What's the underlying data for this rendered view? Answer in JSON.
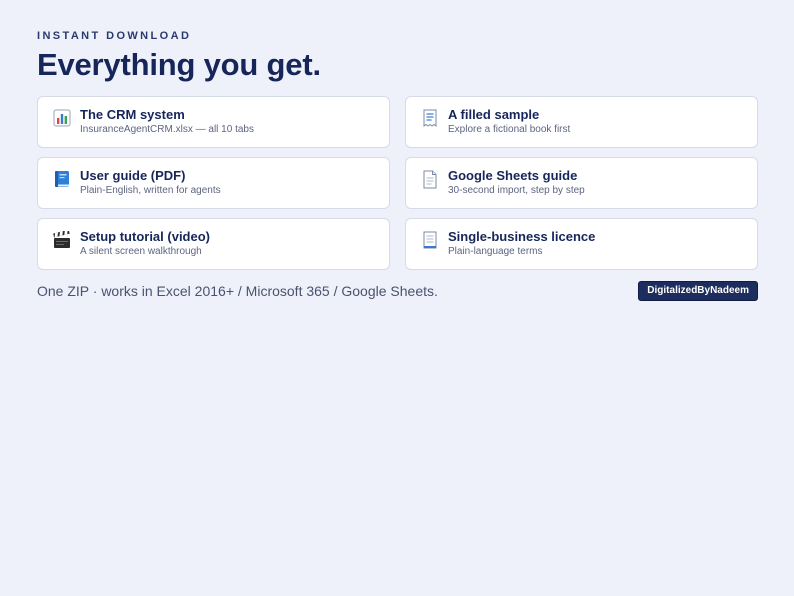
{
  "header": {
    "eyebrow": "INSTANT DOWNLOAD",
    "title": "Everything you get."
  },
  "items": [
    {
      "icon": "bar-chart-icon",
      "label": "The CRM system",
      "desc": "InsuranceAgentCRM.xlsx — all 10 tabs"
    },
    {
      "icon": "receipt-icon",
      "label": "A filled sample",
      "desc": "Explore a fictional book first"
    },
    {
      "icon": "blue-book-icon",
      "label": "User guide (PDF)",
      "desc": "Plain-English, written for agents"
    },
    {
      "icon": "page-icon",
      "label": "Google Sheets guide",
      "desc": "30-second import, step by step"
    },
    {
      "icon": "clapper-board-icon",
      "label": "Setup tutorial (video)",
      "desc": "A silent screen walkthrough"
    },
    {
      "icon": "document-icon",
      "label": "Single-business licence",
      "desc": "Plain-language terms"
    }
  ],
  "footer": {
    "text": "One ZIP · works in Excel 2016+ / Microsoft 365 / Google Sheets.",
    "badge": "DigitalizedByNadeem"
  },
  "colors": {
    "background": "#eef1fa",
    "navy": "#17265a",
    "badge": "#1c2d5e"
  }
}
